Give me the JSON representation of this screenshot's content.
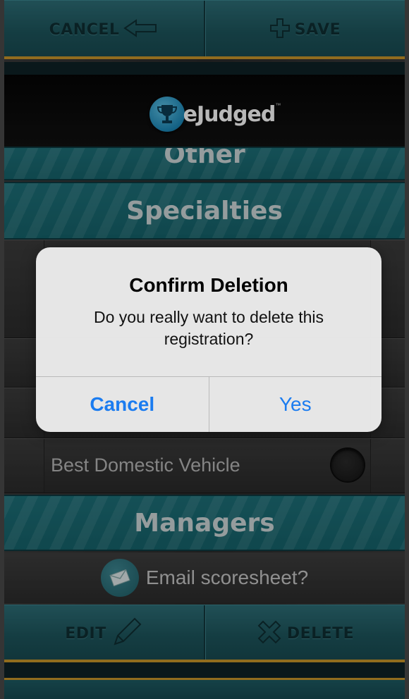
{
  "toolbar_top": {
    "cancel_label": "CANCEL",
    "cancel_icon": "left-arrow-icon",
    "save_label": "SAVE",
    "save_icon": "plus-icon"
  },
  "logo": {
    "text": "eJudged",
    "tm": "™",
    "icon": "trophy-icon"
  },
  "sections": {
    "other": "Other",
    "specialties": "Specialties",
    "managers": "Managers"
  },
  "rows": {
    "best_domestic": "Best Domestic Vehicle"
  },
  "email": {
    "label": "Email scoresheet?",
    "icon": "envelope-icon"
  },
  "toolbar_bottom": {
    "edit_label": "EDIT",
    "edit_icon": "pencil-icon",
    "delete_label": "DELETE",
    "delete_icon": "x-icon"
  },
  "dialog": {
    "title": "Confirm Deletion",
    "message": "Do you really want to delete this registration?",
    "cancel_label": "Cancel",
    "yes_label": "Yes"
  },
  "colors": {
    "teal": "#1d6f78",
    "gold": "#c9962a",
    "ios_blue": "#1b7cf0"
  }
}
